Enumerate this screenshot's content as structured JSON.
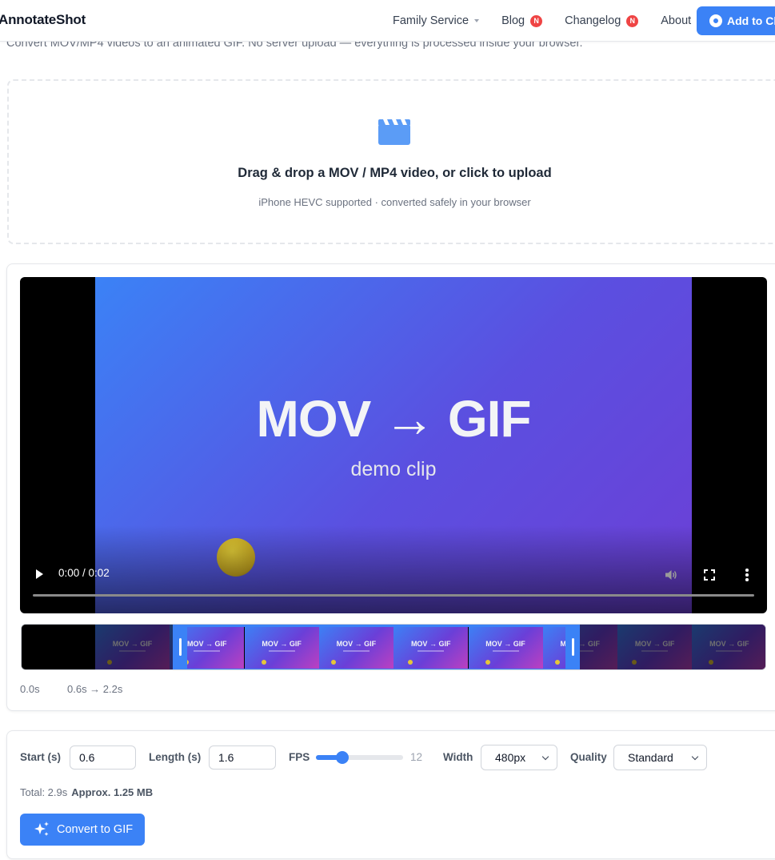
{
  "header": {
    "brand": "AnnotateShot",
    "nav": [
      {
        "label": "Family Service",
        "dropdown": true,
        "badge": ""
      },
      {
        "label": "Blog",
        "dropdown": false,
        "badge": "N"
      },
      {
        "label": "Changelog",
        "dropdown": false,
        "badge": "N"
      },
      {
        "label": "About",
        "dropdown": false,
        "badge": ""
      }
    ],
    "cta_label": "Add to Ch",
    "cta_icon": "chrome-icon"
  },
  "subtitle": "Convert MOV/MP4 videos to an animated GIF. No server upload — everything is processed inside your browser.",
  "dropzone": {
    "icon": "clapperboard-icon",
    "title": "Drag & drop a MOV / MP4 video, or click to upload",
    "hint": "iPhone HEVC supported · converted safely in your browser"
  },
  "video": {
    "frame_title": "MOV → GIF",
    "frame_subtitle": "demo clip",
    "time": "0:00 / 0:02",
    "progress": 0
  },
  "timeline": {
    "thumb_label": "MOV → GIF",
    "thumb_count": 10,
    "start_label": "0.0s",
    "range_label": "0.6s → 2.2s"
  },
  "settings": {
    "start_label": "Start (s)",
    "start_value": "0.6",
    "length_label": "Length (s)",
    "length_value": "1.6",
    "fps_label": "FPS",
    "fps_value": "12",
    "fps_fraction": 0.3,
    "width_label": "Width",
    "width_value": "480px",
    "quality_label": "Quality",
    "quality_value": "Standard",
    "total_text": "Total: 2.9s",
    "approx_text": "Approx. 1.25 MB",
    "convert_label": "Convert to GIF",
    "convert_icon": "sparkles-icon"
  },
  "colors": {
    "accent": "#3b82f6",
    "badge": "#ef4444",
    "frame_gradient_start": "#3b82f6",
    "frame_gradient_end": "#6c3fd6"
  }
}
